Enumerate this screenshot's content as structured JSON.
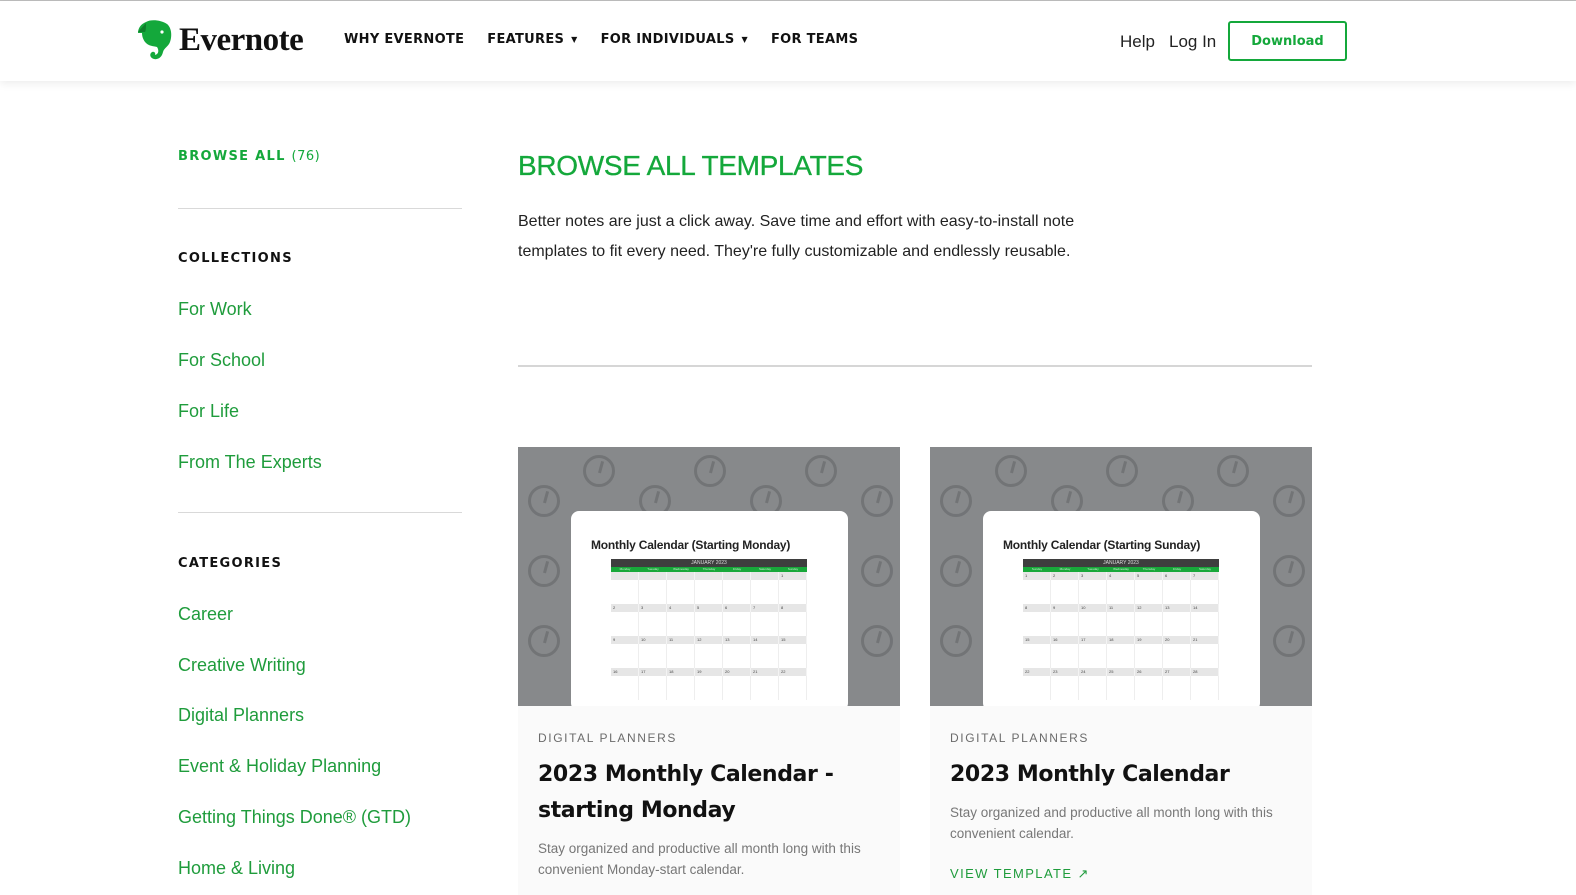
{
  "header": {
    "brand": "Evernote",
    "nav": [
      {
        "label": "WHY EVERNOTE",
        "has_dropdown": false
      },
      {
        "label": "FEATURES",
        "has_dropdown": true
      },
      {
        "label": "FOR INDIVIDUALS",
        "has_dropdown": true
      },
      {
        "label": "FOR TEAMS",
        "has_dropdown": false
      }
    ],
    "caret": "▼",
    "help": "Help",
    "login": "Log In",
    "download": "Download"
  },
  "sidebar": {
    "browse_all_label": "BROWSE ALL",
    "browse_all_count": "(76)",
    "collections_heading": "COLLECTIONS",
    "collections": [
      "For Work",
      "For School",
      "For Life",
      "From The Experts"
    ],
    "categories_heading": "CATEGORIES",
    "categories": [
      "Career",
      "Creative Writing",
      "Digital Planners",
      "Event & Holiday Planning",
      "Getting Things Done® (GTD)",
      "Home & Living"
    ]
  },
  "main": {
    "title": "BROWSE ALL TEMPLATES",
    "intro": "Better notes are just a click away. Save time and effort with easy-to-install note templates to fit every need. They're fully customizable and endlessly reusable."
  },
  "cards": [
    {
      "preview_title": "Monthly Calendar (Starting Monday)",
      "preview_month": "JANUARY 2023",
      "preview_days": [
        "Monday",
        "Tuesday",
        "Wednesday",
        "Thursday",
        "Friday",
        "Saturday",
        "Sunday"
      ],
      "preview_weeks": [
        [
          "",
          "",
          "",
          "",
          "",
          "",
          "1"
        ],
        [
          "2",
          "3",
          "4",
          "5",
          "6",
          "7",
          "8"
        ],
        [
          "9",
          "10",
          "11",
          "12",
          "13",
          "14",
          "15"
        ],
        [
          "16",
          "17",
          "18",
          "19",
          "20",
          "21",
          "22"
        ]
      ],
      "category": "DIGITAL PLANNERS",
      "title": "2023 Monthly Calendar - starting Monday",
      "description": "Stay organized and productive all month long with this convenient Monday-start calendar."
    },
    {
      "preview_title": "Monthly Calendar (Starting Sunday)",
      "preview_month": "JANUARY 2023",
      "preview_days": [
        "Sunday",
        "Monday",
        "Tuesday",
        "Wednesday",
        "Thursday",
        "Friday",
        "Saturday"
      ],
      "preview_weeks": [
        [
          "1",
          "2",
          "3",
          "4",
          "5",
          "6",
          "7"
        ],
        [
          "8",
          "9",
          "10",
          "11",
          "12",
          "13",
          "14"
        ],
        [
          "15",
          "16",
          "17",
          "18",
          "19",
          "20",
          "21"
        ],
        [
          "22",
          "23",
          "24",
          "25",
          "26",
          "27",
          "28"
        ]
      ],
      "category": "DIGITAL PLANNERS",
      "title": "2023 Monthly Calendar",
      "description": "Stay organized and productive all month long with this convenient calendar.",
      "link": "VIEW TEMPLATE ↗"
    }
  ],
  "colors": {
    "brand_green": "#14a83b",
    "link_green": "#1f9c3c",
    "card_image_bg": "#87898b"
  }
}
